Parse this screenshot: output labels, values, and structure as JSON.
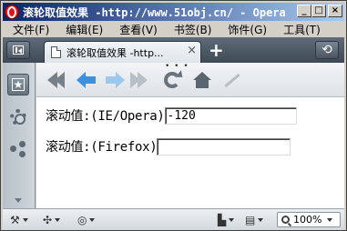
{
  "window": {
    "title": "滚轮取值效果 -http://www.51obj.cn/ - Opera",
    "controls": [
      "_",
      "□",
      "×"
    ]
  },
  "menu": {
    "items": [
      "文件(F)",
      "编辑(E)",
      "查看(V)",
      "书签(B)",
      "饰件(G)",
      "工具(T)"
    ]
  },
  "tabs": {
    "active_title": "滚轮取值效果 -http...",
    "close_glyph": "×",
    "new_tab_glyph": "+",
    "trash_glyph": "⟲"
  },
  "page": {
    "row1_label": "滚动值:(IE/Opera)",
    "row1_value": "-120",
    "row2_label": "滚动值:(Firefox)",
    "row2_value": ""
  },
  "status": {
    "zoom": "100%"
  },
  "icons": {
    "sidebar": [
      "panels-icon",
      "gear-icon",
      "share-icon"
    ],
    "nav": [
      "rewind-icon",
      "back-arrow-icon",
      "forward-arrow-icon",
      "fast-forward-icon",
      "reload-icon",
      "home-icon",
      "wand-icon"
    ]
  },
  "colors": {
    "title_gradient_start": "#0a246a",
    "title_gradient_end": "#a6caf0",
    "tabbar": "#4f5a66",
    "back_arrow": "#3e8fdc"
  }
}
